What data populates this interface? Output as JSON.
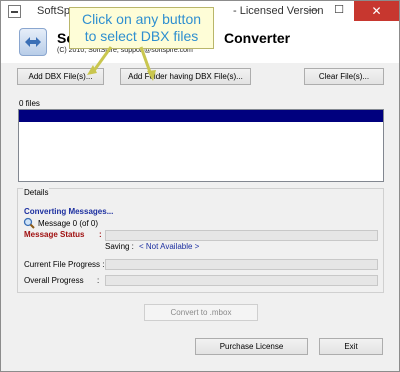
{
  "window": {
    "title_left": "SoftSp",
    "title_right": "- Licensed Version",
    "minimize": "—",
    "maximize": "☐",
    "close": "✕"
  },
  "header": {
    "app_name_left": "So",
    "app_name_right": "Converter",
    "copyright": "(C) 2010, SoftSpire, support@softspire.com"
  },
  "callout": {
    "line1": "Click on any button",
    "line2": "to select DBX files"
  },
  "toolbar": {
    "add_dbx": "Add DBX File(s)...",
    "add_folder": "Add Folder having DBX File(s)...",
    "clear": "Clear File(s)..."
  },
  "file_list": {
    "count_label": "0 files"
  },
  "details": {
    "legend": "Details",
    "converting": "Converting Messages...",
    "message_count": "Message 0 (of 0)",
    "message_status_label": "Message Status",
    "saving_label": "Saving :",
    "saving_value": "< Not Available >",
    "current_progress_label": "Current File Progress :",
    "overall_progress_label": "Overall Progress",
    "current_progress": 0,
    "overall_progress": 0
  },
  "actions": {
    "convert": "Convert to .mbox",
    "purchase": "Purchase License",
    "exit": "Exit"
  },
  "colors": {
    "close": "#c7372f",
    "list_header": "#00007e",
    "callout_bg": "#fefdd7",
    "callout_text": "#2f8fd0"
  }
}
